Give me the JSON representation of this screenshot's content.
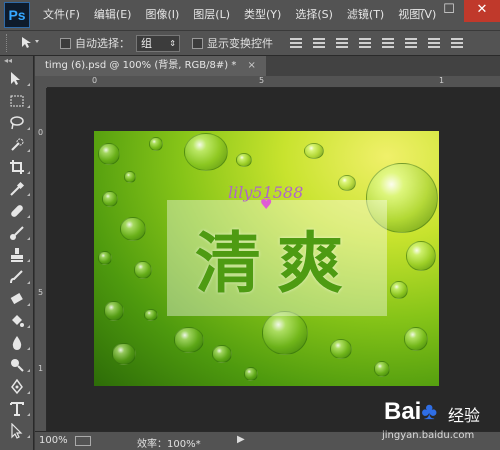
{
  "app": {
    "logo": "Ps"
  },
  "menu": {
    "items": [
      "文件(F)",
      "编辑(E)",
      "图像(I)",
      "图层(L)",
      "类型(Y)",
      "选择(S)",
      "滤镜(T)",
      "视图(V)"
    ]
  },
  "window_controls": {
    "minimize": "—",
    "restore": "☐",
    "close": "✕"
  },
  "options_bar": {
    "auto_select_label": "自动选择：",
    "auto_select_value": "组",
    "show_transform_label": "显示变换控件"
  },
  "document": {
    "tab_title": "timg (6).psd @ 100% (背景, RGB/8#) *",
    "close_glyph": "×"
  },
  "ruler": {
    "top_labels": [
      "0",
      "5",
      "1"
    ],
    "left_labels": [
      "0",
      "5",
      "1"
    ]
  },
  "artwork": {
    "banner_text": "清爽",
    "signature": "lily51588",
    "heart": "♥"
  },
  "status": {
    "zoom": "100%",
    "efficiency": "效率：100%*",
    "arrow": "▶"
  },
  "watermark": {
    "logo_left": "Bai",
    "logo_mid": "♣",
    "logo_right": "经验",
    "url": "jingyan.baidu.com"
  },
  "colors": {
    "menu_bg": "#535353",
    "canvas_bg": "#282828",
    "accent": "#36a7ff",
    "text_green": "#4e9b12"
  }
}
